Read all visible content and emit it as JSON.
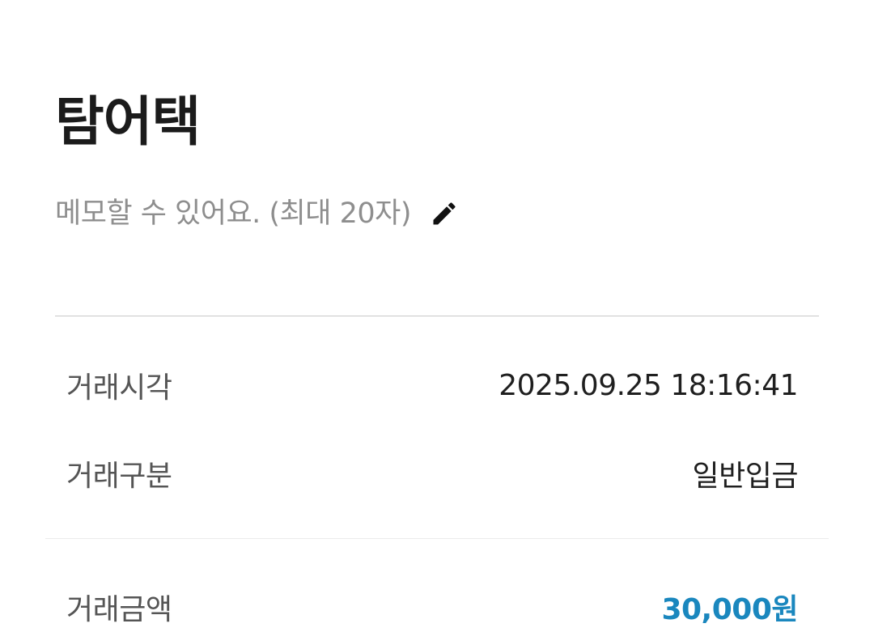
{
  "header": {
    "title": "탐어택",
    "memo_placeholder": "메모할 수 있어요. (최대 20자)",
    "edit_icon": "pencil-icon"
  },
  "details": {
    "time": {
      "label": "거래시각",
      "value": "2025.09.25 18:16:41"
    },
    "type": {
      "label": "거래구분",
      "value": "일반입금"
    },
    "amount": {
      "label": "거래금액",
      "value": "30,000원"
    }
  },
  "colors": {
    "title": "#1b1b1b",
    "memo_text": "#8e8e8e",
    "label_text": "#555555",
    "value_text": "#1f1f1f",
    "amount_accent": "#1a87be",
    "divider": "#c9c9c9"
  }
}
